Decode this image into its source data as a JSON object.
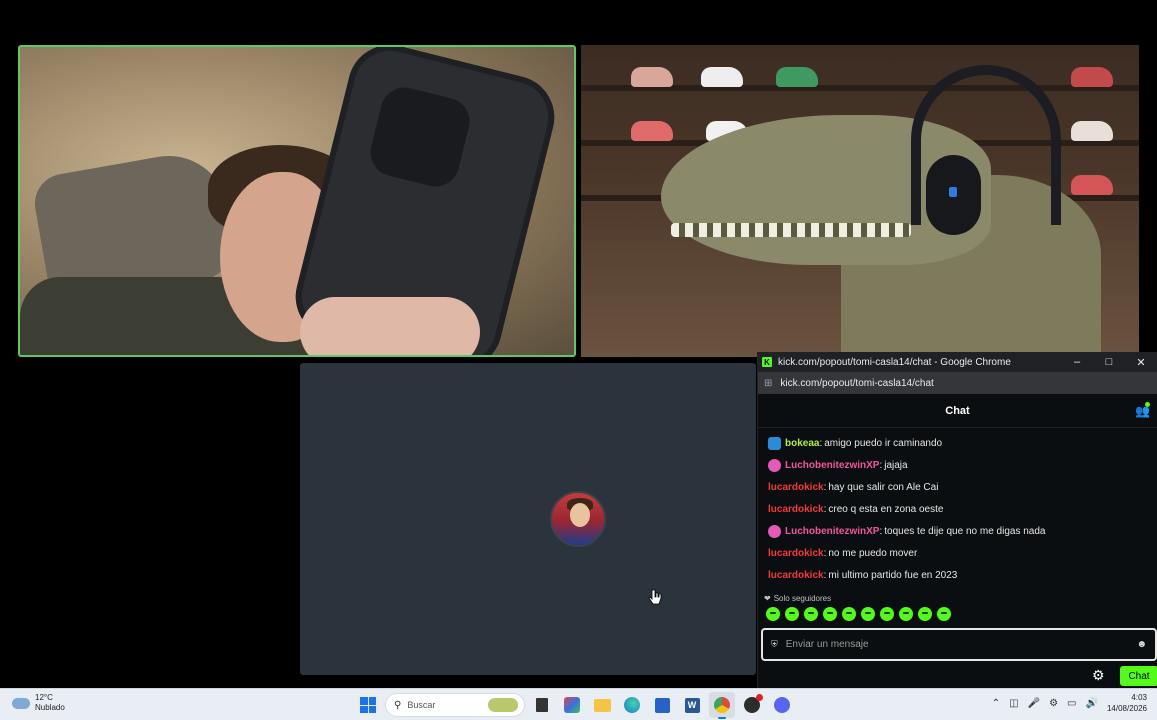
{
  "popout": {
    "window_title": "kick.com/popout/tomi-casla14/chat - Google Chrome",
    "url": "kick.com/popout/tomi-casla14/chat",
    "chat_title": "Chat",
    "messages": [
      {
        "user": "bokeaa",
        "text": "amigo puedo ir caminando",
        "color": "#b4f033",
        "badge": "blue"
      },
      {
        "user": "LuchobenitezwinXP",
        "text": "jajaja",
        "color": "#f0569d",
        "badge": "pink"
      },
      {
        "user": "lucardokick",
        "text": "hay que salir con Ale Cai",
        "color": "#f43a3a",
        "badge": ""
      },
      {
        "user": "lucardokick",
        "text": "creo q esta en zona oeste",
        "color": "#f43a3a",
        "badge": ""
      },
      {
        "user": "LuchobenitezwinXP",
        "text": "toques te dije que no me digas nada",
        "color": "#f0569d",
        "badge": "pink"
      },
      {
        "user": "lucardokick",
        "text": "no me puedo mover",
        "color": "#f43a3a",
        "badge": ""
      },
      {
        "user": "lucardokick",
        "text": "mi ultimo partido fue en 2023",
        "color": "#f43a3a",
        "badge": ""
      }
    ],
    "followers_only": "Solo seguidores",
    "input_placeholder": "Enviar un mensaje",
    "chat_button": "Chat",
    "accent": "#53fc18"
  },
  "taskbar": {
    "temperature": "12°C",
    "weather": "Nublado",
    "search_placeholder": "Buscar",
    "time": "4:03",
    "date": "14/08/2026"
  }
}
